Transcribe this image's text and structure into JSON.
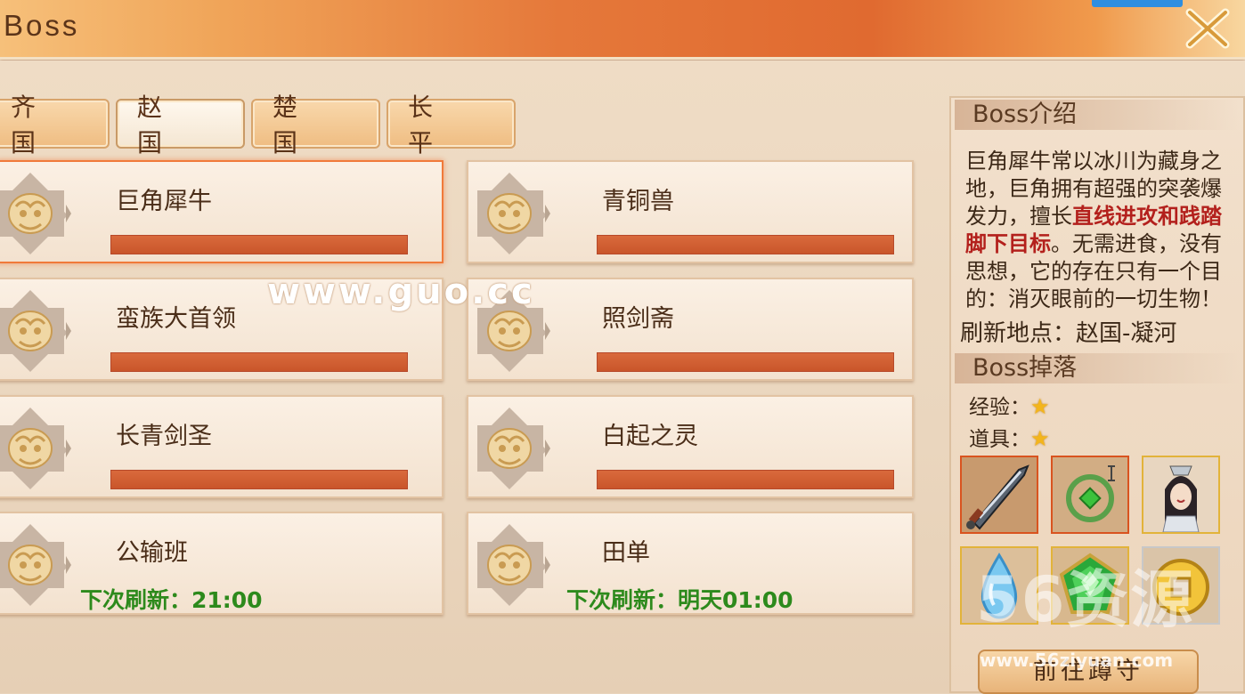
{
  "window": {
    "title": "Boss"
  },
  "tabs": [
    {
      "label": "齐 国",
      "active": false
    },
    {
      "label": "赵 国",
      "active": true
    },
    {
      "label": "楚 国",
      "active": false
    },
    {
      "label": "长 平",
      "active": false
    }
  ],
  "bosses": [
    {
      "name": "巨角犀牛",
      "selected": true,
      "refresh": ""
    },
    {
      "name": "青铜兽",
      "selected": false,
      "refresh": ""
    },
    {
      "name": "蛮族大首领",
      "selected": false,
      "refresh": ""
    },
    {
      "name": "照剑斋",
      "selected": false,
      "refresh": ""
    },
    {
      "name": "长青剑圣",
      "selected": false,
      "refresh": ""
    },
    {
      "name": "白起之灵",
      "selected": false,
      "refresh": ""
    },
    {
      "name": "公输班",
      "selected": false,
      "refresh": "下次刷新：21:00"
    },
    {
      "name": "田单",
      "selected": false,
      "refresh": "下次刷新：明天01:00"
    }
  ],
  "info": {
    "intro_title": "Boss介绍",
    "desc_part1": "巨角犀牛常以冰川为藏身之地，巨角拥有超强的突袭爆发力，擅长",
    "desc_highlight": "直线进攻和践踏脚下目标",
    "desc_part2": "。无需进食，没有思想，它的存在只有一个目的：消灭眼前的一切生物！",
    "refresh_location": "刷新地点：赵国-凝河",
    "drop_title": "Boss掉落",
    "exp_label": "经验：",
    "item_label": "道具：",
    "star_glyph": "★",
    "goto_button": "前往蹲守"
  },
  "drops": [
    {
      "icon": "sword-icon"
    },
    {
      "icon": "jade-pendant-icon"
    },
    {
      "icon": "warrior-portrait-icon"
    },
    {
      "icon": "water-drop-icon"
    },
    {
      "icon": "green-gem-icon"
    },
    {
      "icon": "gold-coin-icon"
    }
  ],
  "watermarks": {
    "center": "www.guo.cc",
    "corner": "56资源",
    "corner_url": "www.56ziyuan.com"
  },
  "colors": {
    "accent": "#e06a30",
    "bar": "#c9552a",
    "highlight": "#b3201c",
    "refresh_green": "#2d8a1c"
  }
}
